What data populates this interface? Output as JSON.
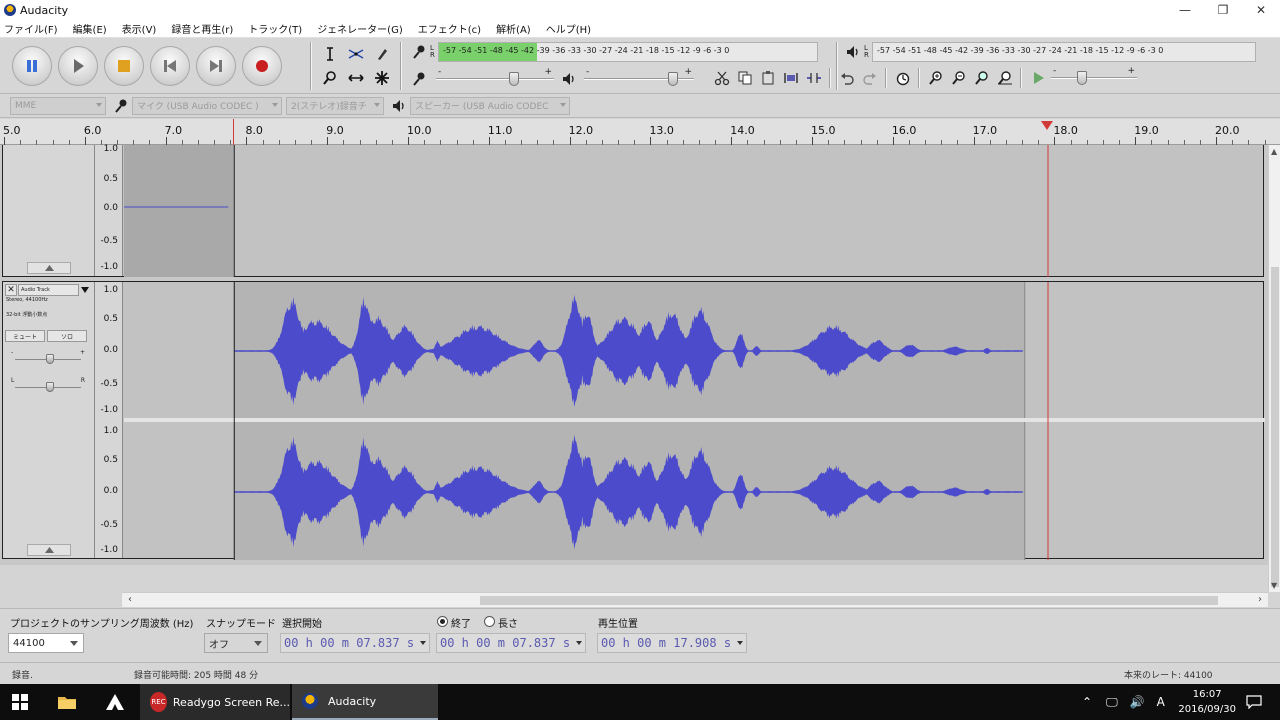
{
  "window": {
    "title": "Audacity",
    "min_icon": "minimize-icon",
    "restore_icon": "restore-icon",
    "close_icon": "close-icon"
  },
  "menu": [
    "ファイル(F)",
    "編集(E)",
    "表示(V)",
    "録音と再生(r)",
    "トラック(T)",
    "ジェネレーター(G)",
    "エフェクト(c)",
    "解析(A)",
    "ヘルプ(H)"
  ],
  "transport": {
    "buttons": [
      "pause-icon",
      "play-icon",
      "stop-icon",
      "skip-start-icon",
      "skip-end-icon",
      "record-icon"
    ],
    "colors": {
      "pause": "#3a6fd8",
      "play": "#5a5a5a",
      "stop": "#e0a020",
      "record": "#c82020"
    }
  },
  "tools": [
    "selection-tool-icon",
    "envelope-tool-icon",
    "draw-tool-icon",
    "zoom-tool-icon",
    "timeshift-tool-icon",
    "multi-tool-icon"
  ],
  "meters": {
    "record": {
      "lr": "L\nR",
      "scale": "-57 -54 -51 -48 -45 -42 -39 -36 -33 -30 -27 -24 -21 -18 -15 -12 -9 -6 -3 0",
      "level": 0.26,
      "color": "#7ad06b"
    },
    "playback": {
      "lr": "L\nR",
      "scale": "-57 -54 -51 -48 -45 -42 -39 -36 -33 -30 -27 -24 -21 -18 -15 -12 -9 -6 -3 0",
      "level": 0
    }
  },
  "mixer": {
    "rec_volume": 0.65,
    "play_volume": 0.82
  },
  "play_at_speed": {
    "level": 0.3
  },
  "devices": {
    "host": "MME",
    "input": "マイク (USB Audio CODEC )",
    "channels": "2(ステレオ)録音チ",
    "output": "スピーカー (USB Audio CODEC"
  },
  "ruler": {
    "labels": [
      "5.0",
      "6.0",
      "7.0",
      "8.0",
      "9.0",
      "10.0",
      "11.0",
      "12.0",
      "13.0",
      "14.0",
      "15.0",
      "16.0",
      "17.0",
      "18.0",
      "19.0",
      "20.0"
    ],
    "play_head": 17.908
  },
  "tracks": {
    "scale_labels": [
      "1.0",
      "0.5",
      "0.0",
      "-0.5",
      "-1.0"
    ],
    "audio_track": {
      "name": "Audio Track",
      "info": "Stereo, 44100Hz",
      "format": "32-bit 浮動小数点",
      "mute": "ミュート",
      "solo": "ソロ",
      "gain_minus": "-",
      "gain_plus": "+",
      "pan_left": "L",
      "pan_right": "R",
      "gain": 0.5,
      "pan": 0.5
    },
    "waveform_color": "#4b4bcc",
    "clip_start": 7.837,
    "clip_end": 17.62
  },
  "selection": {
    "rate_label": "プロジェクトのサンプリング周波数 (Hz)",
    "rate_value": "44100",
    "snap_label": "スナップモード",
    "snap_value": "オフ",
    "start_label": "選択開始",
    "end_label": "終了",
    "length_label": "長さ",
    "start_time": "00 h 00 m 07.837 s",
    "end_time": "00 h 00 m 07.837 s",
    "position_label": "再生位置",
    "position_time": "00 h 00 m 17.908 s"
  },
  "status": {
    "left": "録音.",
    "middle": "録音可能時間: 205 時間 48 分",
    "right": "本来のレート: 44100"
  },
  "taskbar": {
    "tasks": [
      "Readygo Screen Re...",
      "Audacity"
    ],
    "clock_time": "16:07",
    "clock_date": "2016/09/30",
    "ime": "A"
  }
}
